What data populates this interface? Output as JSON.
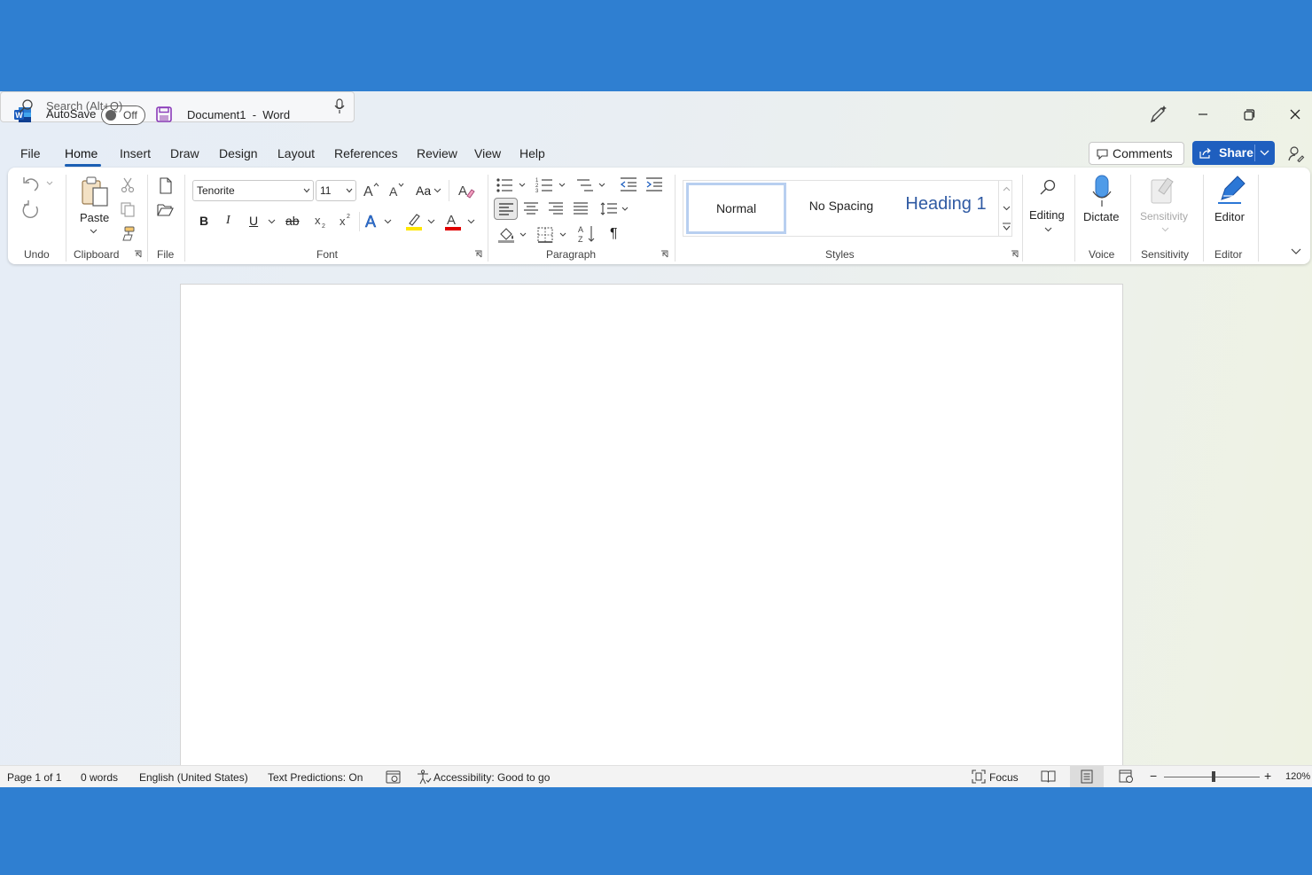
{
  "titlebar": {
    "autosave_label": "AutoSave",
    "autosave_state": "Off",
    "document_title": "Document1  -  Word",
    "search_placeholder": "Search (Alt+Q)"
  },
  "tabs": [
    "File",
    "Home",
    "Insert",
    "Draw",
    "Design",
    "Layout",
    "References",
    "Review",
    "View",
    "Help"
  ],
  "active_tab": "Home",
  "actions": {
    "comments": "Comments",
    "share": "Share"
  },
  "ribbon": {
    "groups": {
      "undo": "Undo",
      "clipboard": "Clipboard",
      "file": "File",
      "font": "Font",
      "paragraph": "Paragraph",
      "styles": "Styles",
      "voice": "Voice",
      "sensitivity": "Sensitivity",
      "editor": "Editor"
    },
    "paste_label": "Paste",
    "font_name": "Tenorite",
    "font_size": "11",
    "change_case_label": "Aa",
    "styles": [
      "Normal",
      "No Spacing",
      "Heading 1"
    ],
    "editing_label": "Editing",
    "dictate_label": "Dictate",
    "sensitivity_label": "Sensitivity",
    "editor_label": "Editor"
  },
  "statusbar": {
    "page": "Page 1 of 1",
    "words": "0 words",
    "language": "English (United States)",
    "text_predictions": "Text Predictions: On",
    "accessibility": "Accessibility: Good to go",
    "focus": "Focus",
    "zoom": "120%"
  },
  "colors": {
    "background": "#2f7fd1",
    "accent": "#1f5fbf",
    "word_logo": "#185abd",
    "highlight": "#ffe600",
    "font_color": "#e00000"
  },
  "zoom_level_percent": 120
}
